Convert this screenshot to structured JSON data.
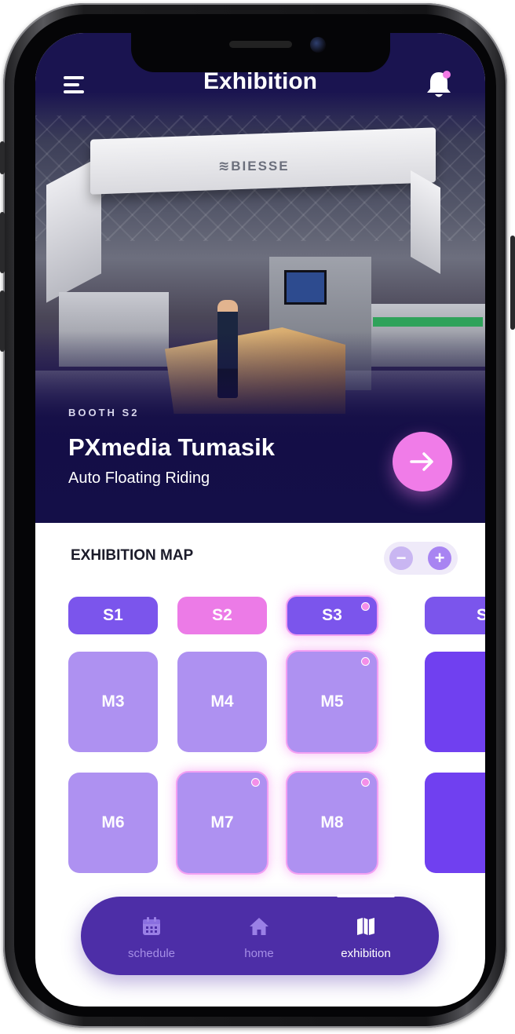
{
  "app": {
    "title": "Exhibition"
  },
  "hero": {
    "banner_logo_text": "≋BIESSE",
    "booth_label": "BOOTH S2",
    "booth_name": "PXmedia Tumasik",
    "booth_subtitle": "Auto Floating Riding"
  },
  "map": {
    "title": "EXHIBITION MAP",
    "zoom_out": "−",
    "zoom_in": "+",
    "stands_row": [
      {
        "label": "S1",
        "style": "dark",
        "marked": false
      },
      {
        "label": "S2",
        "style": "pink",
        "marked": false
      },
      {
        "label": "S3",
        "style": "dark",
        "marked": true
      },
      {
        "label": "S",
        "style": "dark",
        "marked": false
      }
    ],
    "booth_row_1": [
      {
        "label": "M3",
        "style": "light",
        "marked": false
      },
      {
        "label": "M4",
        "style": "light",
        "marked": false
      },
      {
        "label": "M5",
        "style": "light",
        "marked": true
      },
      {
        "label": "",
        "style": "violet",
        "marked": false
      }
    ],
    "booth_row_2": [
      {
        "label": "M6",
        "style": "light",
        "marked": false
      },
      {
        "label": "M7",
        "style": "light",
        "marked": true
      },
      {
        "label": "M8",
        "style": "light",
        "marked": true
      },
      {
        "label": "",
        "style": "violet",
        "marked": false
      }
    ]
  },
  "nav": {
    "items": [
      {
        "label": "schedule",
        "icon": "calendar-icon",
        "active": false
      },
      {
        "label": "home",
        "icon": "home-icon",
        "active": false
      },
      {
        "label": "exhibition",
        "icon": "map-icon",
        "active": true
      }
    ]
  },
  "colors": {
    "hero_bg": "#140f48",
    "accent_pink": "#ec7be7",
    "tile_dark": "#7b55ec",
    "tile_light": "#ae91f1",
    "tile_violet": "#7040f0",
    "nav_bg": "#4d2ea7"
  }
}
